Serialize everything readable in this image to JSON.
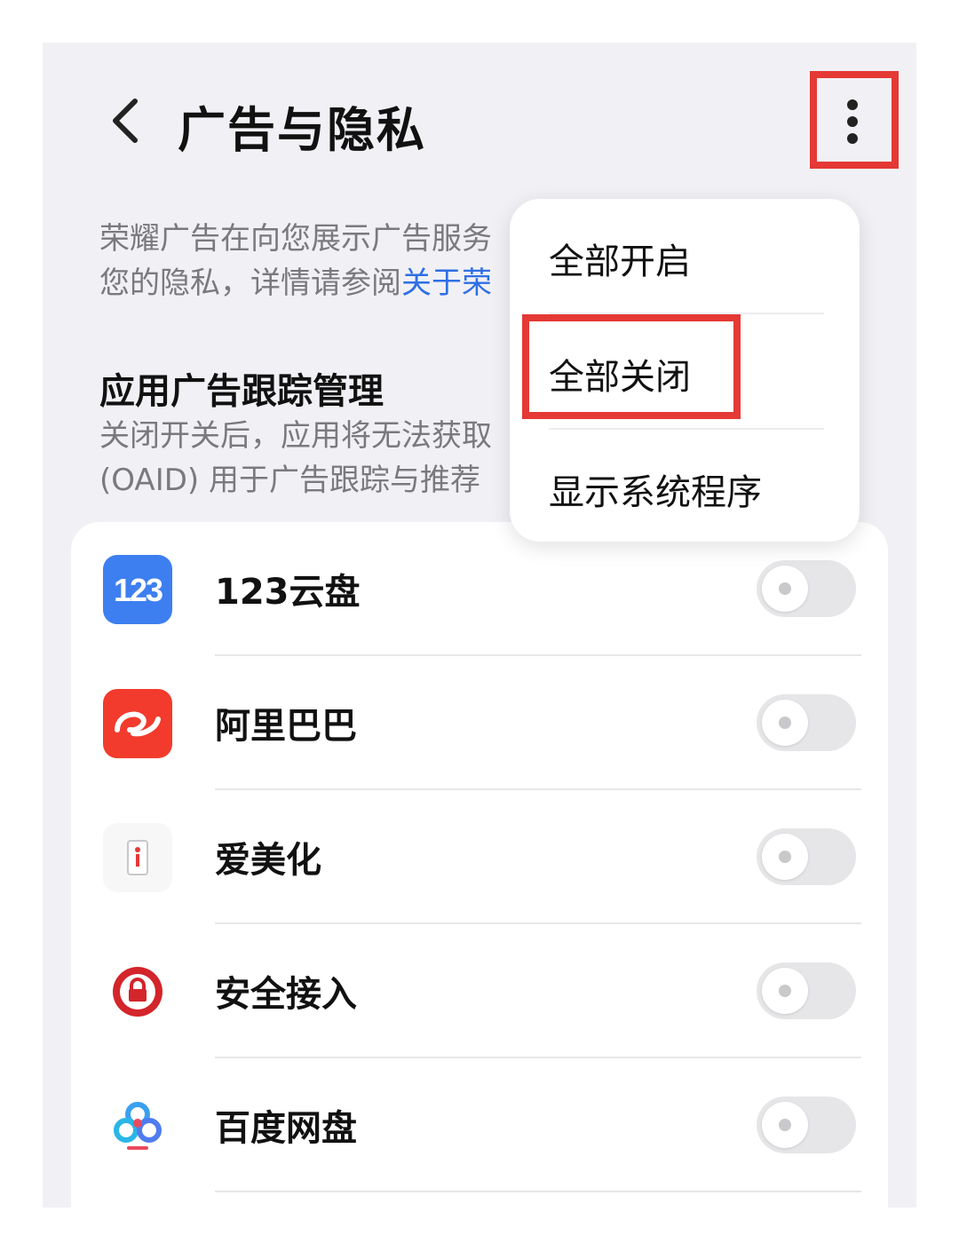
{
  "header": {
    "title": "广告与隐私",
    "back_icon": "chevron-left-icon",
    "more_icon": "more-vertical-icon"
  },
  "description": {
    "line1": "荣耀广告在向您展示广告服务",
    "line2_prefix": "您的隐私，详情请参阅",
    "line2_link": "关于荣"
  },
  "section": {
    "title": "应用广告跟踪管理",
    "desc_line1": "关闭开关后，应用将无法获取",
    "desc_line2": "(OAID) 用于广告跟踪与推荐"
  },
  "apps": [
    {
      "name": "123云盘",
      "icon": "123-cloud-icon",
      "enabled": false
    },
    {
      "name": "阿里巴巴",
      "icon": "alibaba-icon",
      "enabled": false
    },
    {
      "name": "爱美化",
      "icon": "aimeihua-icon",
      "enabled": false
    },
    {
      "name": "安全接入",
      "icon": "lock-icon",
      "enabled": false
    },
    {
      "name": "百度网盘",
      "icon": "baidu-netdisk-icon",
      "enabled": false
    }
  ],
  "menu": {
    "items": [
      "全部开启",
      "全部关闭",
      "显示系统程序"
    ],
    "highlighted_index": 1
  },
  "colors": {
    "accent_link": "#2f6fe4",
    "highlight_border": "#e53935",
    "background": "#f1f1f5"
  }
}
